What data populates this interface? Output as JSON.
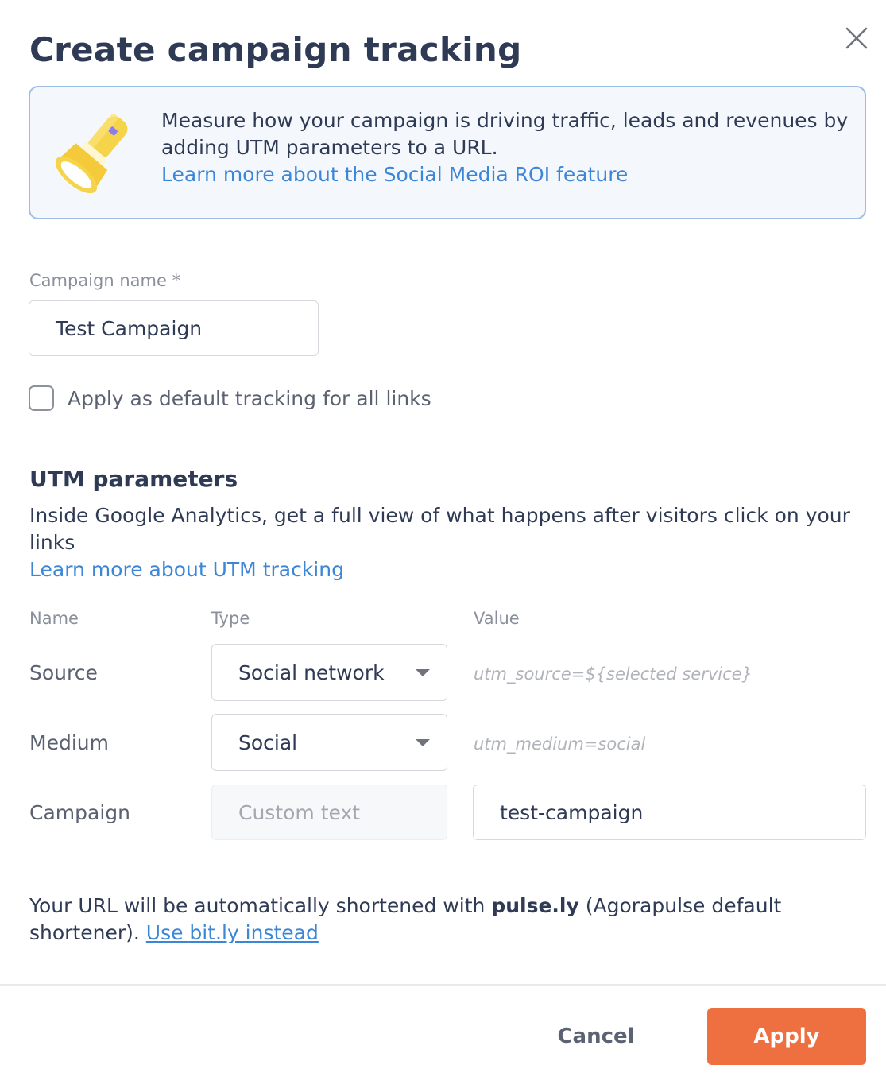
{
  "dialog": {
    "title": "Create campaign tracking",
    "close_icon": "close-icon"
  },
  "info": {
    "icon": "flashlight-icon",
    "text": "Measure how your campaign is driving traffic, leads and revenues by adding UTM parameters to a URL.",
    "link": "Learn more about the Social Media ROI feature"
  },
  "campaign_name": {
    "label": "Campaign name *",
    "value": "Test Campaign"
  },
  "default_tracking": {
    "label": "Apply as default tracking for all links",
    "checked": false
  },
  "utm": {
    "title": "UTM parameters",
    "description": "Inside Google Analytics, get a full view of what happens after visitors click on your links",
    "link": "Learn more about UTM tracking",
    "columns": [
      "Name",
      "Type",
      "Value"
    ],
    "rows": [
      {
        "name": "Source",
        "type": "Social network",
        "value": "utm_source=${selected service}"
      },
      {
        "name": "Medium",
        "type": "Social",
        "value": "utm_medium=social"
      },
      {
        "name": "Campaign",
        "type_placeholder": "Custom text",
        "value": "test-campaign"
      }
    ]
  },
  "shortener": {
    "text_before": "Your URL will be automatically shortened with ",
    "bold": "pulse.ly",
    "text_after": " (Agorapulse default shortener). ",
    "link": "Use bit.ly instead"
  },
  "footer": {
    "cancel_label": "Cancel",
    "apply_label": "Apply"
  },
  "colors": {
    "accent": "#ee7040",
    "link": "#3b86d6",
    "info_border": "#9dbde6",
    "info_bg": "#f4f8fc"
  }
}
